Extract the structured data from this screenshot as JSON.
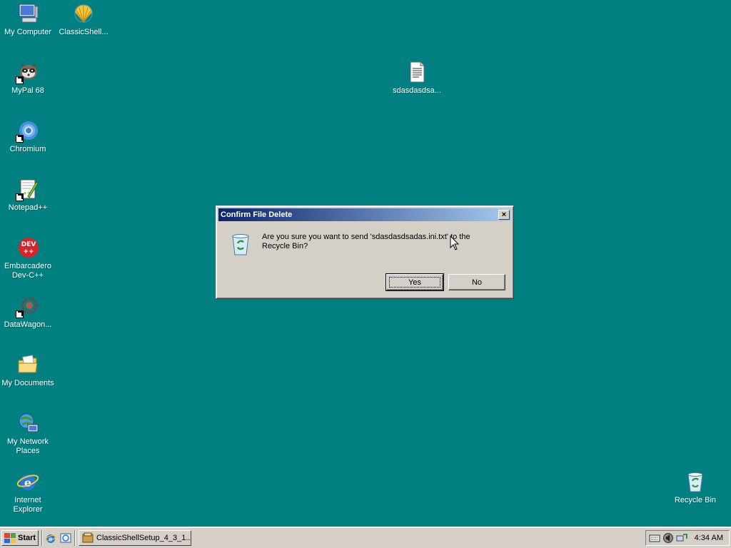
{
  "desktop": {
    "background": "#008080",
    "icons": [
      {
        "label": "My Computer",
        "icon": "computer-icon"
      },
      {
        "label": "ClassicShell...",
        "icon": "shell-icon"
      },
      {
        "label": "MyPal 68",
        "icon": "raccoon-icon"
      },
      {
        "label": "Chromium",
        "icon": "chromium-icon"
      },
      {
        "label": "Notepad++",
        "icon": "notepad-plus-icon"
      },
      {
        "label": "Embarcadero Dev-C++",
        "icon": "devcpp-icon"
      },
      {
        "label": "DataWagon...",
        "icon": "gear-icon"
      },
      {
        "label": "My Documents",
        "icon": "folder-icon"
      },
      {
        "label": "My Network Places",
        "icon": "network-icon"
      },
      {
        "label": "Internet Explorer",
        "icon": "ie-icon"
      },
      {
        "label": "sdasdasdsa...",
        "icon": "text-file-icon"
      },
      {
        "label": "Recycle Bin",
        "icon": "recycle-bin-icon"
      }
    ]
  },
  "dialog": {
    "title": "Confirm File Delete",
    "message": "Are you sure you want to send 'sdasdasdsadas.ini.txt' to the Recycle Bin?",
    "yes_label": "Yes",
    "no_label": "No",
    "close_label": "×"
  },
  "taskbar": {
    "start_label": "Start",
    "task_label": "ClassicShellSetup_4_3_1...",
    "clock": "4:34 AM"
  }
}
